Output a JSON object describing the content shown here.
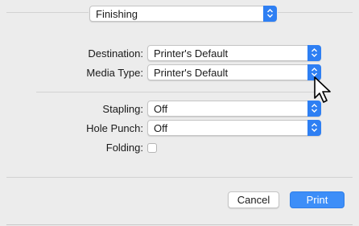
{
  "section_popup": {
    "value": "Finishing"
  },
  "fields": {
    "destination": {
      "label": "Destination:",
      "value": "Printer's Default"
    },
    "media_type": {
      "label": "Media Type:",
      "value": "Printer's Default"
    },
    "stapling": {
      "label": "Stapling:",
      "value": "Off"
    },
    "hole_punch": {
      "label": "Hole Punch:",
      "value": "Off"
    },
    "folding": {
      "label": "Folding:",
      "checked": false
    }
  },
  "buttons": {
    "cancel": "Cancel",
    "print": "Print"
  },
  "colors": {
    "accent": "#2e7ff3",
    "background": "#ececec",
    "primary_button": "#3d8ef8"
  },
  "cursor": {
    "icon": "mouse-pointer-icon"
  }
}
